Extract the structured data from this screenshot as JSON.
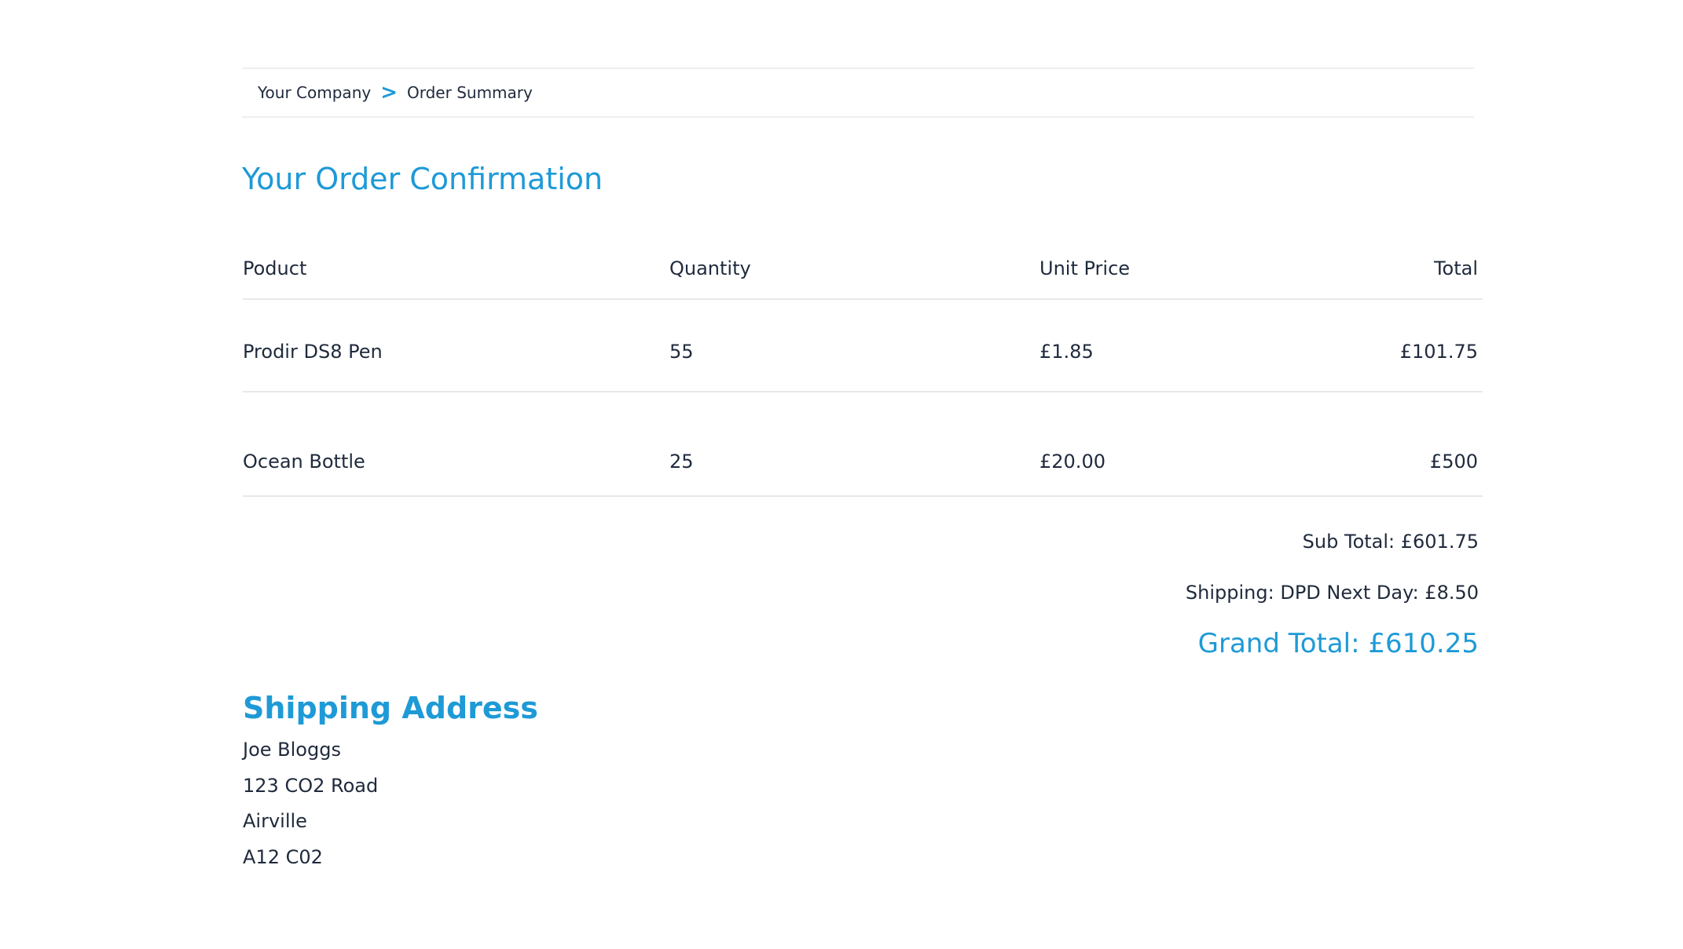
{
  "breadcrumb": {
    "home": "Your Company",
    "separator": ">",
    "current": "Order Summary"
  },
  "page_title": "Your Order Confirmation",
  "table": {
    "headers": {
      "product": "Poduct",
      "quantity": "Quantity",
      "unit_price": "Unit Price",
      "total": "Total"
    },
    "rows": [
      {
        "product": "Prodir DS8 Pen",
        "quantity": "55",
        "unit_price": "£1.85",
        "total": "£101.75"
      },
      {
        "product": "Ocean Bottle",
        "quantity": "25",
        "unit_price": "£20.00",
        "total": "£500"
      }
    ]
  },
  "summary": {
    "subtotal": "Sub Total: £601.75",
    "shipping": "Shipping: DPD Next Day: £8.50",
    "grand_total": "Grand Total: £610.25"
  },
  "shipping_address": {
    "title": "Shipping Address",
    "lines": [
      "Joe Bloggs",
      "123 CO2 Road",
      "Airville",
      "A12 C02"
    ]
  },
  "colors": {
    "accent": "#1e9ad6",
    "text": "#1f2a3c",
    "divider": "#e6e8eb"
  }
}
